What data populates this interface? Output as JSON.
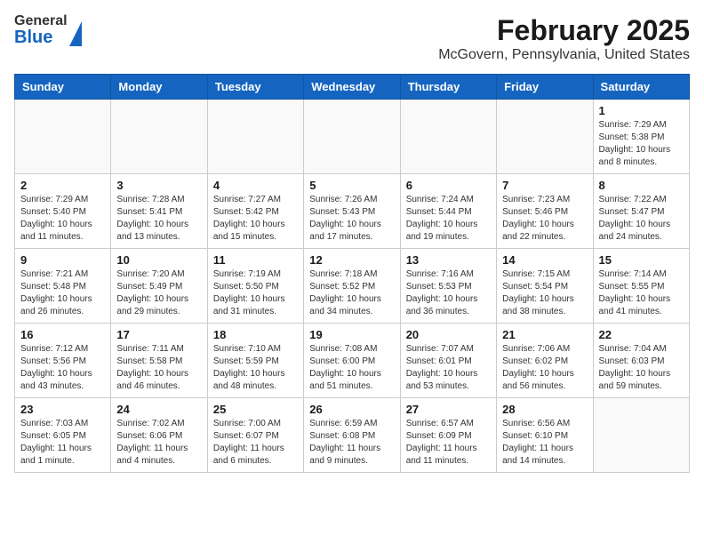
{
  "header": {
    "logo_general": "General",
    "logo_blue": "Blue",
    "title": "February 2025",
    "subtitle": "McGovern, Pennsylvania, United States"
  },
  "weekdays": [
    "Sunday",
    "Monday",
    "Tuesday",
    "Wednesday",
    "Thursday",
    "Friday",
    "Saturday"
  ],
  "weeks": [
    [
      {
        "day": "",
        "info": ""
      },
      {
        "day": "",
        "info": ""
      },
      {
        "day": "",
        "info": ""
      },
      {
        "day": "",
        "info": ""
      },
      {
        "day": "",
        "info": ""
      },
      {
        "day": "",
        "info": ""
      },
      {
        "day": "1",
        "info": "Sunrise: 7:29 AM\nSunset: 5:38 PM\nDaylight: 10 hours and 8 minutes."
      }
    ],
    [
      {
        "day": "2",
        "info": "Sunrise: 7:29 AM\nSunset: 5:40 PM\nDaylight: 10 hours and 11 minutes."
      },
      {
        "day": "3",
        "info": "Sunrise: 7:28 AM\nSunset: 5:41 PM\nDaylight: 10 hours and 13 minutes."
      },
      {
        "day": "4",
        "info": "Sunrise: 7:27 AM\nSunset: 5:42 PM\nDaylight: 10 hours and 15 minutes."
      },
      {
        "day": "5",
        "info": "Sunrise: 7:26 AM\nSunset: 5:43 PM\nDaylight: 10 hours and 17 minutes."
      },
      {
        "day": "6",
        "info": "Sunrise: 7:24 AM\nSunset: 5:44 PM\nDaylight: 10 hours and 19 minutes."
      },
      {
        "day": "7",
        "info": "Sunrise: 7:23 AM\nSunset: 5:46 PM\nDaylight: 10 hours and 22 minutes."
      },
      {
        "day": "8",
        "info": "Sunrise: 7:22 AM\nSunset: 5:47 PM\nDaylight: 10 hours and 24 minutes."
      }
    ],
    [
      {
        "day": "9",
        "info": "Sunrise: 7:21 AM\nSunset: 5:48 PM\nDaylight: 10 hours and 26 minutes."
      },
      {
        "day": "10",
        "info": "Sunrise: 7:20 AM\nSunset: 5:49 PM\nDaylight: 10 hours and 29 minutes."
      },
      {
        "day": "11",
        "info": "Sunrise: 7:19 AM\nSunset: 5:50 PM\nDaylight: 10 hours and 31 minutes."
      },
      {
        "day": "12",
        "info": "Sunrise: 7:18 AM\nSunset: 5:52 PM\nDaylight: 10 hours and 34 minutes."
      },
      {
        "day": "13",
        "info": "Sunrise: 7:16 AM\nSunset: 5:53 PM\nDaylight: 10 hours and 36 minutes."
      },
      {
        "day": "14",
        "info": "Sunrise: 7:15 AM\nSunset: 5:54 PM\nDaylight: 10 hours and 38 minutes."
      },
      {
        "day": "15",
        "info": "Sunrise: 7:14 AM\nSunset: 5:55 PM\nDaylight: 10 hours and 41 minutes."
      }
    ],
    [
      {
        "day": "16",
        "info": "Sunrise: 7:12 AM\nSunset: 5:56 PM\nDaylight: 10 hours and 43 minutes."
      },
      {
        "day": "17",
        "info": "Sunrise: 7:11 AM\nSunset: 5:58 PM\nDaylight: 10 hours and 46 minutes."
      },
      {
        "day": "18",
        "info": "Sunrise: 7:10 AM\nSunset: 5:59 PM\nDaylight: 10 hours and 48 minutes."
      },
      {
        "day": "19",
        "info": "Sunrise: 7:08 AM\nSunset: 6:00 PM\nDaylight: 10 hours and 51 minutes."
      },
      {
        "day": "20",
        "info": "Sunrise: 7:07 AM\nSunset: 6:01 PM\nDaylight: 10 hours and 53 minutes."
      },
      {
        "day": "21",
        "info": "Sunrise: 7:06 AM\nSunset: 6:02 PM\nDaylight: 10 hours and 56 minutes."
      },
      {
        "day": "22",
        "info": "Sunrise: 7:04 AM\nSunset: 6:03 PM\nDaylight: 10 hours and 59 minutes."
      }
    ],
    [
      {
        "day": "23",
        "info": "Sunrise: 7:03 AM\nSunset: 6:05 PM\nDaylight: 11 hours and 1 minute."
      },
      {
        "day": "24",
        "info": "Sunrise: 7:02 AM\nSunset: 6:06 PM\nDaylight: 11 hours and 4 minutes."
      },
      {
        "day": "25",
        "info": "Sunrise: 7:00 AM\nSunset: 6:07 PM\nDaylight: 11 hours and 6 minutes."
      },
      {
        "day": "26",
        "info": "Sunrise: 6:59 AM\nSunset: 6:08 PM\nDaylight: 11 hours and 9 minutes."
      },
      {
        "day": "27",
        "info": "Sunrise: 6:57 AM\nSunset: 6:09 PM\nDaylight: 11 hours and 11 minutes."
      },
      {
        "day": "28",
        "info": "Sunrise: 6:56 AM\nSunset: 6:10 PM\nDaylight: 11 hours and 14 minutes."
      },
      {
        "day": "",
        "info": ""
      }
    ]
  ]
}
